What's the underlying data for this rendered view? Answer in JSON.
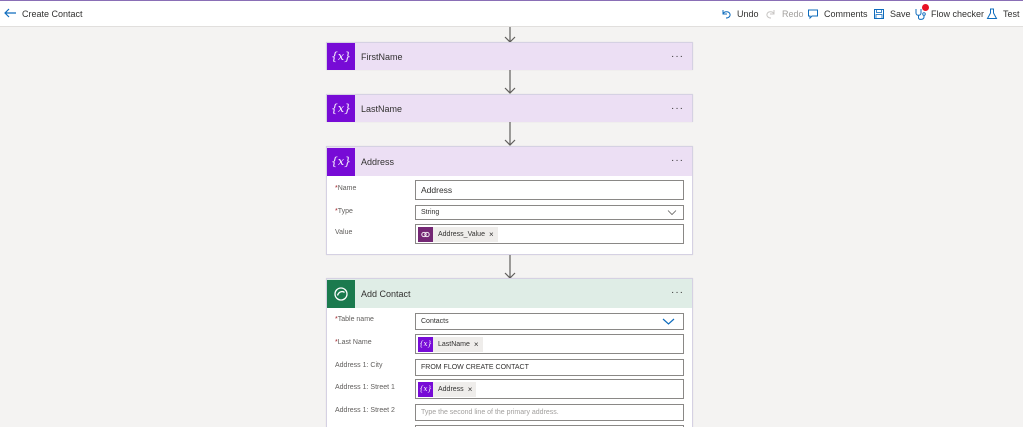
{
  "header": {
    "title": "Create Contact",
    "undo": "Undo",
    "redo": "Redo",
    "comments": "Comments",
    "save": "Save",
    "flow_checker": "Flow checker",
    "test": "Test"
  },
  "colors": {
    "variable_purple": "#770bd6",
    "dataverse_green": "#1b7a4e",
    "accent_blue": "#0f6cbd",
    "alert_red": "#e81123"
  },
  "steps": {
    "first_name": {
      "title": "FirstName",
      "icon": "{x}",
      "more": "···"
    },
    "last_name": {
      "title": "LastName",
      "icon": "{x}",
      "more": "···"
    },
    "address": {
      "title": "Address",
      "icon": "{x}",
      "more": "···",
      "name_label": "Name",
      "name_value": "Address",
      "type_label": "Type",
      "type_value": "String",
      "value_label": "Value",
      "value_token": "Address_Value"
    },
    "add_contact": {
      "title": "Add Contact",
      "more": "···",
      "table_label": "Table name",
      "table_value": "Contacts",
      "lastname_label": "Last Name",
      "lastname_token": "LastName",
      "city_label": "Address 1: City",
      "city_value": "FROM FLOW CREATE CONTACT",
      "street1_label": "Address 1: Street 1",
      "street1_token": "Address",
      "street2_label": "Address 1: Street 2",
      "street2_placeholder": "Type the second line of the primary address."
    }
  },
  "required_mark": "*",
  "token_remove": "×"
}
